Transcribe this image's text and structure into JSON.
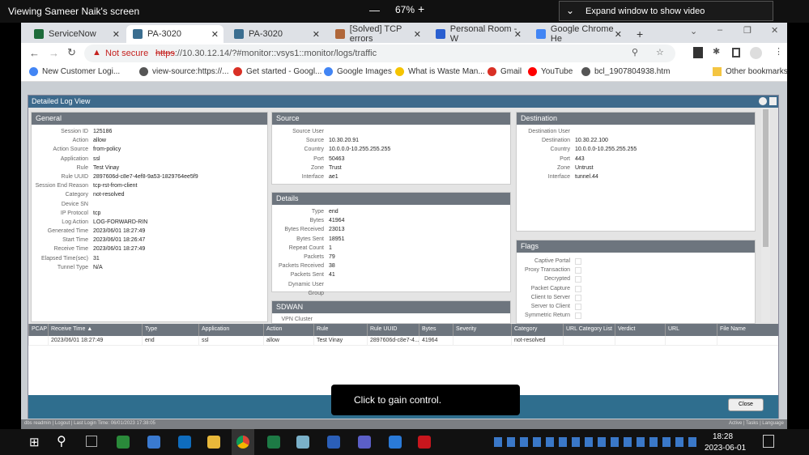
{
  "viewer": {
    "title": "Viewing Sameer Naik's screen",
    "zoom": "67%",
    "minus": "—",
    "plus": "+",
    "expand": "Expand window to show video"
  },
  "tabs": [
    {
      "label": "ServiceNow",
      "color": "#1d6b3a"
    },
    {
      "label": "PA-3020",
      "color": "#3b6e90"
    },
    {
      "label": "PA-3020",
      "color": "#3b6e90"
    },
    {
      "label": "[Solved] TCP errors",
      "color": "#b0673a"
    },
    {
      "label": "Personal Room - W",
      "color": "#2a5fd0"
    },
    {
      "label": "Google Chrome He",
      "color": "#4285f4"
    }
  ],
  "address": {
    "security": "Not secure",
    "scheme": "https",
    "url": "://10.30.12.14/?#monitor::vsys1::monitor/logs/traffic"
  },
  "bookmarks": [
    {
      "label": "New Customer Logi...",
      "color": "#4285f4"
    },
    {
      "label": "view-source:https://...",
      "color": "#555"
    },
    {
      "label": "Get started - Googl...",
      "color": "#d93025"
    },
    {
      "label": "Google Images",
      "color": "#4285f4"
    },
    {
      "label": "What is Waste Man...",
      "color": "#f5c400"
    },
    {
      "label": "Gmail",
      "color": "#d93025"
    },
    {
      "label": "YouTube",
      "color": "#f00"
    },
    {
      "label": "bcl_1907804938.htm",
      "color": "#555"
    }
  ],
  "other_bookmarks": "Other bookmarks",
  "dialog": {
    "title": "Detailed Log View",
    "close": "Close"
  },
  "general": {
    "title": "General",
    "rows": [
      [
        "Session ID",
        "125186"
      ],
      [
        "Action",
        "allow"
      ],
      [
        "Action Source",
        "from-policy"
      ],
      [
        "Application",
        "ssl"
      ],
      [
        "Rule",
        "Test Vinay"
      ],
      [
        "Rule UUID",
        "2897606d-c8e7-4ef8-9a53-1829764ee5f9"
      ],
      [
        "Session End Reason",
        "tcp-rst-from-client"
      ],
      [
        "Category",
        "not-resolved"
      ],
      [
        "Device SN",
        ""
      ],
      [
        "IP Protocol",
        "tcp"
      ],
      [
        "Log Action",
        "LOG-FORWARD-RIN"
      ],
      [
        "Generated Time",
        "2023/06/01 18:27:49"
      ],
      [
        "Start Time",
        "2023/06/01 18:26:47"
      ],
      [
        "Receive Time",
        "2023/06/01 18:27:49"
      ],
      [
        "Elapsed Time(sec)",
        "31"
      ],
      [
        "Tunnel Type",
        "N/A"
      ]
    ]
  },
  "source": {
    "title": "Source",
    "rows": [
      [
        "Source User",
        ""
      ],
      [
        "Source",
        "10.30.20.91"
      ],
      [
        "Country",
        "10.0.0.0-10.255.255.255"
      ],
      [
        "Port",
        "50463"
      ],
      [
        "Zone",
        "Trust"
      ],
      [
        "Interface",
        "ae1"
      ]
    ]
  },
  "details": {
    "title": "Details",
    "rows": [
      [
        "Type",
        "end"
      ],
      [
        "Bytes",
        "41964"
      ],
      [
        "Bytes Received",
        "23013"
      ],
      [
        "Bytes Sent",
        "18951"
      ],
      [
        "Repeat Count",
        "1"
      ],
      [
        "Packets",
        "79"
      ],
      [
        "Packets Received",
        "38"
      ],
      [
        "Packets Sent",
        "41"
      ],
      [
        "Dynamic User Group",
        ""
      ]
    ]
  },
  "sdwan": {
    "title": "SDWAN",
    "rows": [
      [
        "VPN Cluster Name",
        ""
      ]
    ]
  },
  "destination": {
    "title": "Destination",
    "rows": [
      [
        "Destination User",
        ""
      ],
      [
        "Destination",
        "10.30.22.100"
      ],
      [
        "Country",
        "10.0.0.0-10.255.255.255"
      ],
      [
        "Port",
        "443"
      ],
      [
        "Zone",
        "Untrust"
      ],
      [
        "Interface",
        "tunnel.44"
      ]
    ]
  },
  "flags": {
    "title": "Flags",
    "items": [
      "Captive Portal",
      "Proxy Transaction",
      "Decrypted",
      "Packet Capture",
      "Client to Server",
      "Server to Client",
      "Symmetric Return"
    ]
  },
  "table": {
    "columns": [
      "PCAP",
      "Receive Time ▲",
      "Type",
      "Application",
      "Action",
      "Rule",
      "Rule UUID",
      "Bytes",
      "Severity",
      "Category",
      "URL Category List",
      "Verdict",
      "URL",
      "File Name"
    ],
    "rows": [
      [
        "",
        "2023/06/01 18:27:49",
        "end",
        "ssl",
        "allow",
        "Test Vinay",
        "2897606d-c8e7-4...",
        "41964",
        "",
        "not-resolved",
        "",
        "",
        "",
        ""
      ]
    ]
  },
  "tooltip": "Click to gain control.",
  "status": {
    "left": "dbs readmin | Logout | Last Login Time: 06/01/2023 17:38:05",
    "right": "Active | Tasks | Language"
  },
  "taskbar": {
    "time": "18:28",
    "date": "2023-06-01"
  }
}
